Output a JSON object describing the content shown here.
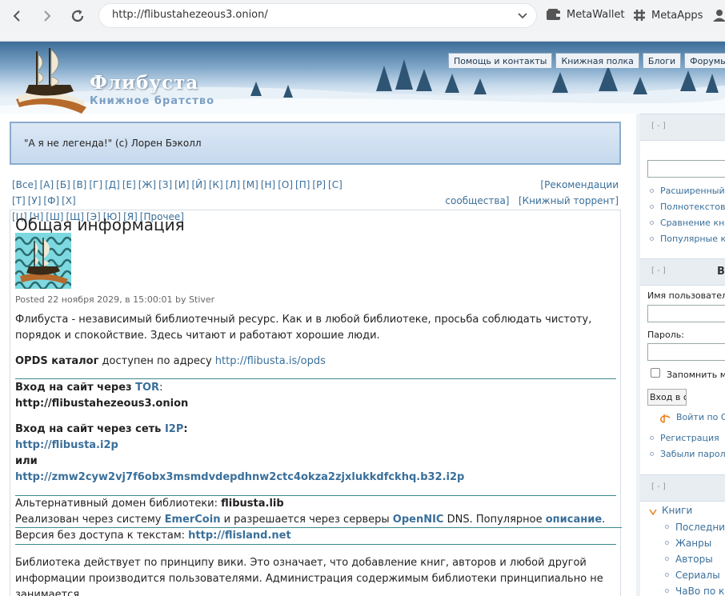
{
  "browser": {
    "url": "http://flibustahezeous3.onion/",
    "ext1": "MetaWallet",
    "ext2": "MetaApps"
  },
  "site": {
    "title": "Флибуста",
    "slogan": "Книжное братство",
    "tabs": [
      "Помощь и контакты",
      "Книжная полка",
      "Блоги",
      "Форумы"
    ]
  },
  "quote": "\"А я не легенда!\" (с) Лорен Бэколл",
  "alphabet": [
    "[Все]",
    "[А]",
    "[Б]",
    "[В]",
    "[Г]",
    "[Д]",
    "[Е]",
    "[Ж]",
    "[З]",
    "[И]",
    "[Й]",
    "[К]",
    "[Л]",
    "[М]",
    "[Н]",
    "[О]",
    "[П]",
    "[Р]",
    "[С]",
    "[Т]",
    "[У]",
    "[Ф]",
    "[Х]",
    "[Ц]",
    "[Ч]",
    "[Ш]",
    "[Щ]",
    "[Э]",
    "[Ю]",
    "[Я]",
    "[Прочее]"
  ],
  "rec": {
    "line1": "[Рекомендации",
    "line2a": "сообщества]",
    "line2b": "[Книжный торрент]"
  },
  "post": {
    "heading": "Общая информация",
    "posted": "Posted 22 ноября 2029, в 15:00:01 by Stiver",
    "intro": "Флибуста - независимый библиотечный ресурс. Как и в любой библиотеке, просьба соблюдать чистоту, порядок и спокойствие. Здесь читают и работают хорошие люди.",
    "opds_label": "OPDS каталог",
    "opds_text": " доступен по адресу ",
    "opds_link": "http://flibusta.is/opds",
    "tor_label": "Вход на сайт через ",
    "tor_link": "TOR",
    "tor_colon": ":",
    "tor_addr": "http://flibustahezeous3.onion",
    "i2p_label": "Вход на сайт через сеть ",
    "i2p_link": "I2P",
    "i2p_colon": ":",
    "i2p_addr": "http://flibusta.i2p",
    "or": "или",
    "i2p_addr2": "http://zmw2cyw2vj7f6obx3msmdvdepdhnw2ctc4okza2zjxlukkdfckhq.b32.i2p",
    "alt_text": "Альтернативный домен библиотеки: ",
    "alt_domain": "flibusta.lib",
    "emer_text1": "Реализован через систему ",
    "emer_link": "EmerCoin",
    "emer_text2": " и разрешается через серверы ",
    "opennic_link": "OpenNIC",
    "emer_text3": " DNS. Популярное ",
    "desc_link": "описание",
    "emer_text4": ".",
    "noaccess_text": "Версия без доступа к текстам: ",
    "noaccess_link": "http://flisland.net",
    "wiki": "Библиотека действует по принципу вики. Это означает, что добавление книг, авторов и любой другой информации производится пользователями. Администрация содержимым библиотеки принципиально не занимается."
  },
  "sidebar": {
    "toggle": "[ - ]",
    "search_links": [
      "Расширенный",
      "Полнотекстов",
      "Сравнение кни",
      "Популярные к"
    ],
    "login_title": "В",
    "username_label": "Имя пользовател",
    "password_label": "Пароль:",
    "remember_label": "Запомнить м",
    "login_button": "Вход в с",
    "openid_link": "Войти по О",
    "register_link": "Регистрация",
    "forgot_link": "Забыли парол",
    "books_label": "Книги",
    "books_items": [
      "Последние",
      "Жанры",
      "Авторы",
      "Сериалы",
      "ЧаВо по кн"
    ]
  }
}
